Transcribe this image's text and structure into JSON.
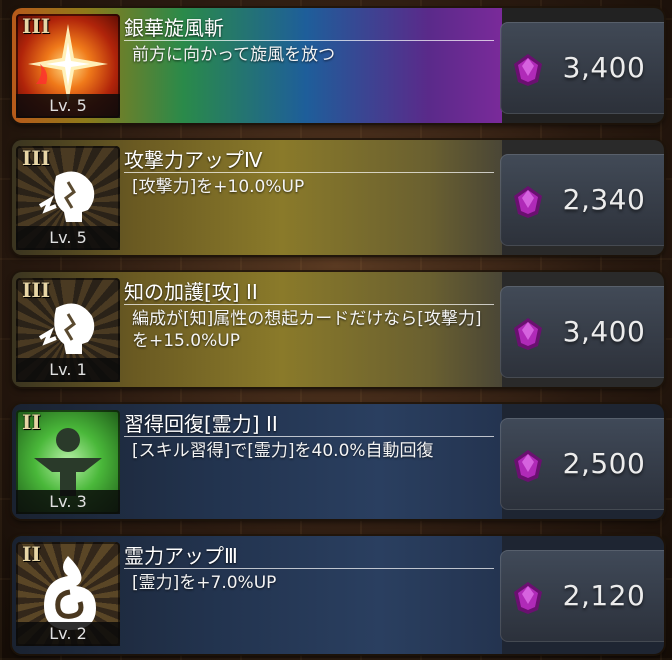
{
  "skills": [
    {
      "rank": "III",
      "level": "Lv. 5",
      "name": "銀華旋風斬",
      "description": "前方に向かって旋風を放つ",
      "cost": "3,400",
      "icon": "sparkle-burst-icon"
    },
    {
      "rank": "III",
      "level": "Lv. 5",
      "name": "攻撃力アップⅣ",
      "description": "[攻撃力]を+10.0%UP",
      "cost": "2,340",
      "icon": "cracked-head-icon"
    },
    {
      "rank": "III",
      "level": "Lv. 1",
      "name": "知の加護[攻] II",
      "description": "編成が[知]属性の想起カードだけなら[攻撃力]を+15.0%UP",
      "cost": "3,400",
      "icon": "cracked-head-icon"
    },
    {
      "rank": "II",
      "level": "Lv. 3",
      "name": "習得回復[霊力] II",
      "description": "[スキル習得]で[霊力]を40.0%自動回復",
      "cost": "2,500",
      "icon": "spirit-figure-icon"
    },
    {
      "rank": "II",
      "level": "Lv. 2",
      "name": "霊力アップⅢ",
      "description": "[霊力]を+7.0%UP",
      "cost": "2,120",
      "icon": "flame-swirl-icon"
    }
  ],
  "colors": {
    "gem": "#8a1a8e",
    "rank_text": "#e8d6a6"
  }
}
